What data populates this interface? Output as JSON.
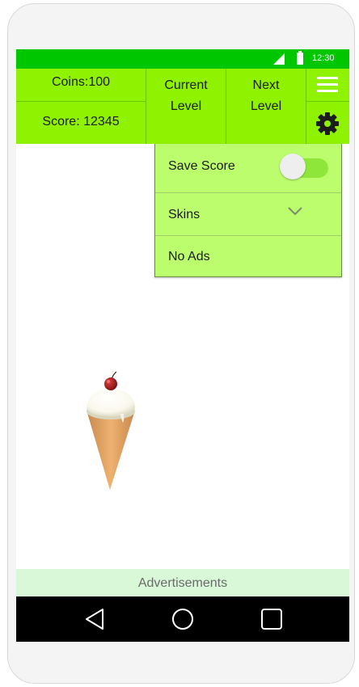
{
  "status_bar": {
    "time": "12:30",
    "signal_icon": "signal-icon",
    "battery_icon": "battery-icon",
    "color": "#00c600"
  },
  "top_bar": {
    "coins": "Coins:100",
    "score": "Score: 12345",
    "current_level": [
      "Current",
      "Level"
    ],
    "next_level": [
      "Next",
      "Level"
    ],
    "menu_icon": "hamburger-menu-icon",
    "settings_icon": "gear-icon",
    "color": "#8ff200"
  },
  "settings_panel": {
    "save_score_label": "Save Score",
    "save_score_enabled": false,
    "skins_label": "Skins",
    "no_ads_label": "No Ads",
    "color": "#bcfd6d"
  },
  "game": {
    "sprite": "ice-cream-cone-icon"
  },
  "ad_bar": {
    "label": "Advertisements",
    "color": "#d8f8d8"
  },
  "nav_bar": {
    "back_icon": "back-triangle-icon",
    "home_icon": "home-circle-icon",
    "recent_icon": "recent-apps-square-icon"
  }
}
